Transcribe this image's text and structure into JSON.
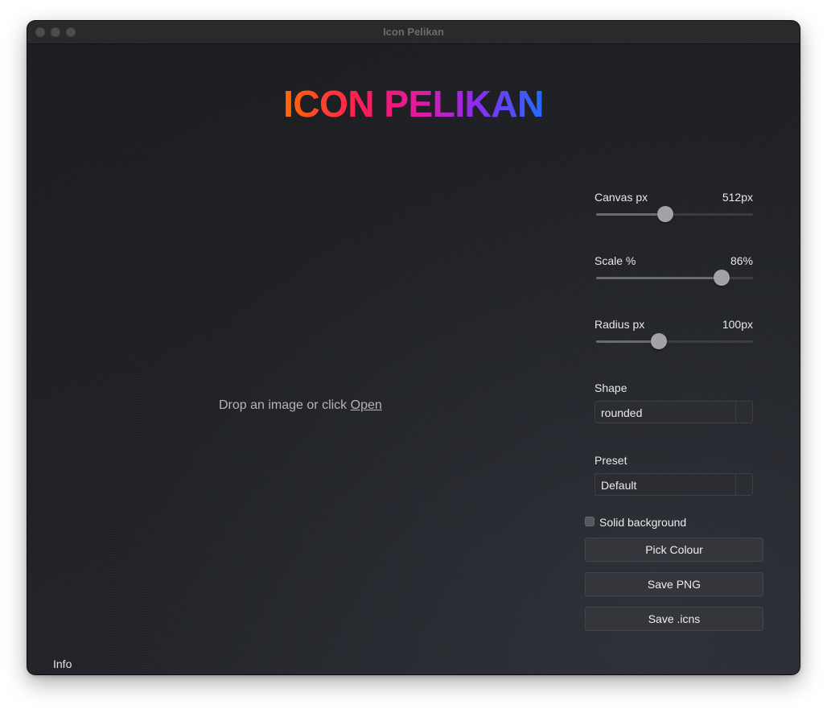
{
  "window": {
    "title": "Icon Pelikan"
  },
  "header": {
    "app_title": "ICON PELIKAN",
    "gradient_colors": [
      "#ff6a00",
      "#ff1b58",
      "#e11aa0",
      "#8b2cf2",
      "#1f6dff"
    ]
  },
  "drop_zone": {
    "hint_text": "Drop an image or click ",
    "link_text": "Open"
  },
  "footer": {
    "info_label": "Info"
  },
  "controls": {
    "canvas": {
      "label": "Canvas px",
      "value_text": "512px",
      "fraction": 0.44
    },
    "scale": {
      "label": "Scale %",
      "value_text": "86%",
      "fraction": 0.8
    },
    "radius": {
      "label": "Radius px",
      "value_text": "100px",
      "fraction": 0.4
    },
    "shape": {
      "label": "Shape",
      "selected": "rounded"
    },
    "preset": {
      "label": "Preset",
      "selected": "Default"
    },
    "solid_background": {
      "label": "Solid background",
      "checked": false
    },
    "buttons": {
      "pick_colour": "Pick Colour",
      "save_png": "Save PNG",
      "save_icns": "Save .icns"
    }
  }
}
